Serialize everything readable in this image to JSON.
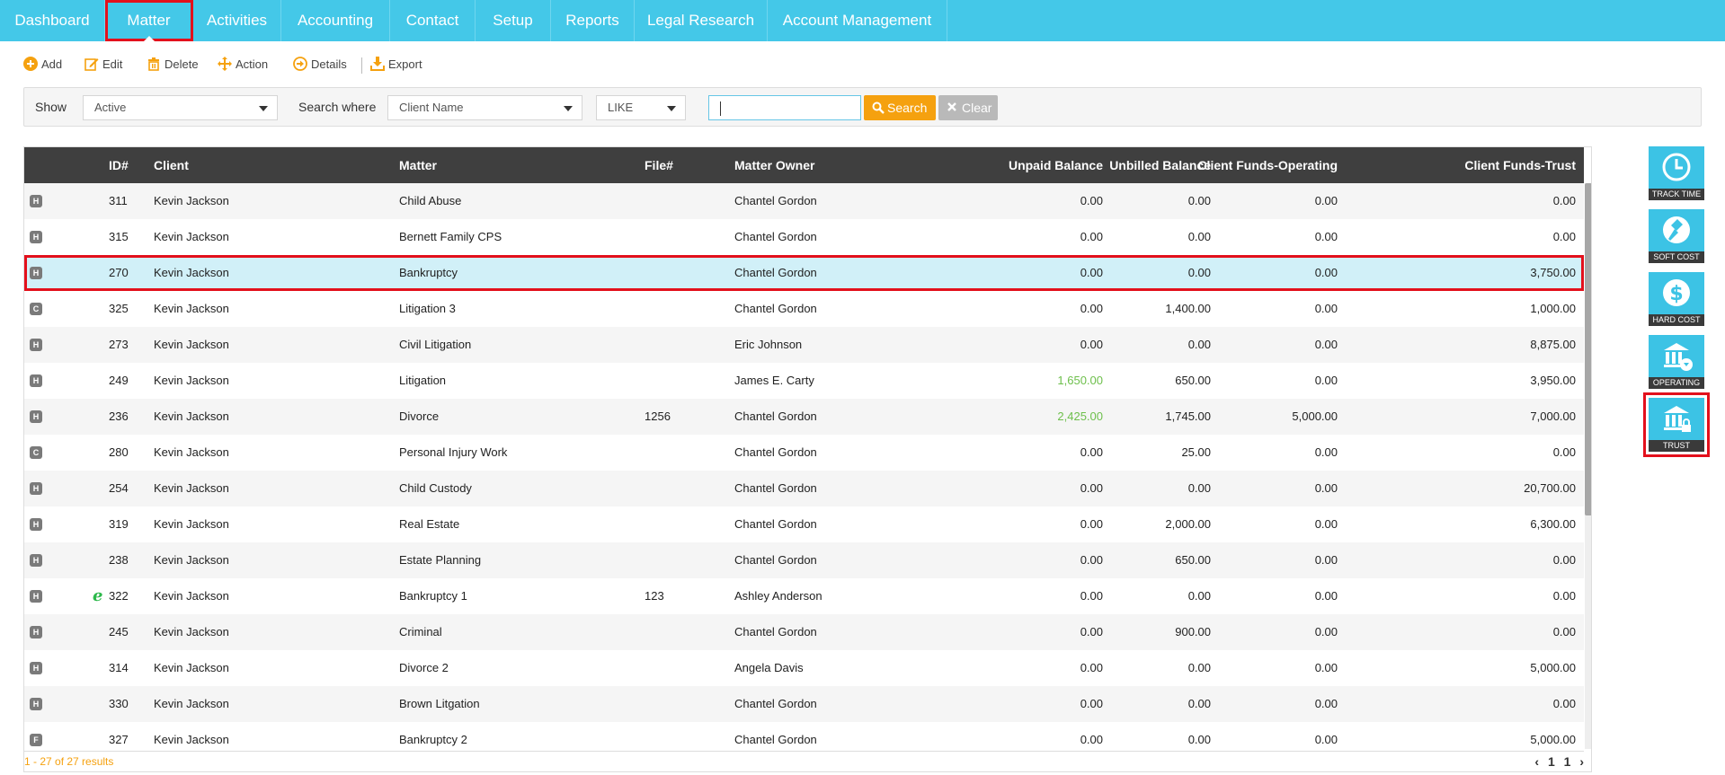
{
  "nav": {
    "tabs": [
      {
        "label": "Dashboard"
      },
      {
        "label": "Matter"
      },
      {
        "label": "Activities"
      },
      {
        "label": "Accounting"
      },
      {
        "label": "Contact"
      },
      {
        "label": "Setup"
      },
      {
        "label": "Reports"
      },
      {
        "label": "Legal Research"
      },
      {
        "label": "Account Management"
      }
    ],
    "active": "Matter"
  },
  "toolbar": {
    "add": "Add",
    "edit": "Edit",
    "delete": "Delete",
    "action": "Action",
    "details": "Details",
    "export": "Export"
  },
  "filter": {
    "show_label": "Show",
    "show_value": "Active",
    "search_where_label": "Search where",
    "search_where_value": "Client Name",
    "operator_value": "LIKE",
    "search_input_value": "",
    "search_button": "Search",
    "clear_button": "Clear"
  },
  "grid": {
    "columns": [
      "ID#",
      "Client",
      "Matter",
      "File#",
      "Matter Owner",
      "Unpaid Balance",
      "Unbilled Balance",
      "Client Funds-Operating",
      "Client Funds-Trust"
    ],
    "rows": [
      {
        "badge": "H",
        "e": "",
        "id": "311",
        "client": "Kevin Jackson",
        "matter": "Child Abuse",
        "file": "",
        "owner": "Chantel Gordon",
        "unpaid": "0.00",
        "unbilled": "0.00",
        "operating": "0.00",
        "trust": "0.00"
      },
      {
        "badge": "H",
        "e": "",
        "id": "315",
        "client": "Kevin Jackson",
        "matter": "Bernett Family CPS",
        "file": "",
        "owner": "Chantel Gordon",
        "unpaid": "0.00",
        "unbilled": "0.00",
        "operating": "0.00",
        "trust": "0.00"
      },
      {
        "badge": "H",
        "e": "",
        "id": "270",
        "client": "Kevin Jackson",
        "matter": "Bankruptcy",
        "file": "",
        "owner": "Chantel Gordon",
        "unpaid": "0.00",
        "unbilled": "0.00",
        "operating": "0.00",
        "trust": "3,750.00"
      },
      {
        "badge": "C",
        "e": "",
        "id": "325",
        "client": "Kevin Jackson",
        "matter": "Litigation 3",
        "file": "",
        "owner": "Chantel Gordon",
        "unpaid": "0.00",
        "unbilled": "1,400.00",
        "operating": "0.00",
        "trust": "1,000.00"
      },
      {
        "badge": "H",
        "e": "",
        "id": "273",
        "client": "Kevin Jackson",
        "matter": "Civil Litigation",
        "file": "",
        "owner": "Eric Johnson",
        "unpaid": "0.00",
        "unbilled": "0.00",
        "operating": "0.00",
        "trust": "8,875.00"
      },
      {
        "badge": "H",
        "e": "",
        "id": "249",
        "client": "Kevin Jackson",
        "matter": "Litigation",
        "file": "",
        "owner": "James E. Carty",
        "unpaid": "1,650.00",
        "unbilled": "650.00",
        "operating": "0.00",
        "trust": "3,950.00"
      },
      {
        "badge": "H",
        "e": "",
        "id": "236",
        "client": "Kevin Jackson",
        "matter": "Divorce",
        "file": "1256",
        "owner": "Chantel Gordon",
        "unpaid": "2,425.00",
        "unbilled": "1,745.00",
        "operating": "5,000.00",
        "trust": "7,000.00"
      },
      {
        "badge": "C",
        "e": "",
        "id": "280",
        "client": "Kevin Jackson",
        "matter": "Personal Injury Work",
        "file": "",
        "owner": "Chantel Gordon",
        "unpaid": "0.00",
        "unbilled": "25.00",
        "operating": "0.00",
        "trust": "0.00"
      },
      {
        "badge": "H",
        "e": "",
        "id": "254",
        "client": "Kevin Jackson",
        "matter": "Child Custody",
        "file": "",
        "owner": "Chantel Gordon",
        "unpaid": "0.00",
        "unbilled": "0.00",
        "operating": "0.00",
        "trust": "20,700.00"
      },
      {
        "badge": "H",
        "e": "",
        "id": "319",
        "client": "Kevin Jackson",
        "matter": "Real Estate",
        "file": "",
        "owner": "Chantel Gordon",
        "unpaid": "0.00",
        "unbilled": "2,000.00",
        "operating": "0.00",
        "trust": "6,300.00"
      },
      {
        "badge": "H",
        "e": "",
        "id": "238",
        "client": "Kevin Jackson",
        "matter": "Estate Planning",
        "file": "",
        "owner": "Chantel Gordon",
        "unpaid": "0.00",
        "unbilled": "650.00",
        "operating": "0.00",
        "trust": "0.00"
      },
      {
        "badge": "H",
        "e": "e",
        "id": "322",
        "client": "Kevin Jackson",
        "matter": "Bankruptcy 1",
        "file": "123",
        "owner": "Ashley Anderson",
        "unpaid": "0.00",
        "unbilled": "0.00",
        "operating": "0.00",
        "trust": "0.00"
      },
      {
        "badge": "H",
        "e": "",
        "id": "245",
        "client": "Kevin Jackson",
        "matter": "Criminal",
        "file": "",
        "owner": "Chantel Gordon",
        "unpaid": "0.00",
        "unbilled": "900.00",
        "operating": "0.00",
        "trust": "0.00"
      },
      {
        "badge": "H",
        "e": "",
        "id": "314",
        "client": "Kevin Jackson",
        "matter": "Divorce 2",
        "file": "",
        "owner": "Angela Davis",
        "unpaid": "0.00",
        "unbilled": "0.00",
        "operating": "0.00",
        "trust": "5,000.00"
      },
      {
        "badge": "H",
        "e": "",
        "id": "330",
        "client": "Kevin Jackson",
        "matter": "Brown Litgation",
        "file": "",
        "owner": "Chantel Gordon",
        "unpaid": "0.00",
        "unbilled": "0.00",
        "operating": "0.00",
        "trust": "0.00"
      },
      {
        "badge": "F",
        "e": "",
        "id": "327",
        "client": "Kevin Jackson",
        "matter": "Bankruptcy 2",
        "file": "",
        "owner": "Chantel Gordon",
        "unpaid": "0.00",
        "unbilled": "0.00",
        "operating": "0.00",
        "trust": "5,000.00"
      }
    ],
    "selected_id": "270",
    "results_text": "1 - 27 of 27 results",
    "pager": {
      "prev": "‹",
      "page": "1",
      "total": "1",
      "next": "›"
    }
  },
  "side_buttons": [
    {
      "label": "TRACK TIME",
      "icon": "clock-icon"
    },
    {
      "label": "SOFT COST",
      "icon": "gavel-icon"
    },
    {
      "label": "HARD COST",
      "icon": "dollar-icon"
    },
    {
      "label": "OPERATING",
      "icon": "bank-download-icon"
    },
    {
      "label": "TRUST",
      "icon": "bank-lock-icon"
    }
  ],
  "colors": {
    "nav_bg": "#44c8e8",
    "accent_orange": "#f5a10f",
    "header_dark": "#3f3f3f",
    "selected_row": "#d1f0f8",
    "highlight_red": "#e3101c",
    "positive_green": "#6dbf4b"
  }
}
